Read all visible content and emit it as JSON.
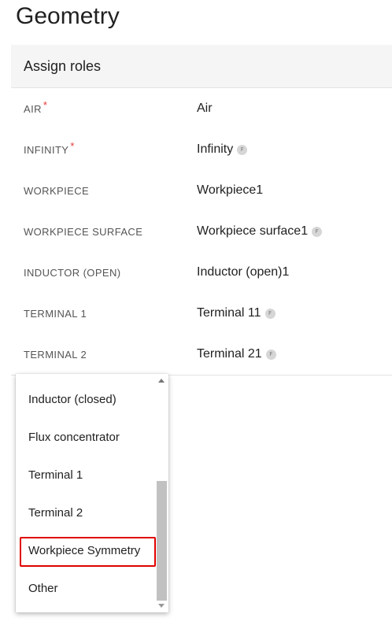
{
  "page": {
    "title": "Geometry"
  },
  "section": {
    "title": "Assign roles"
  },
  "roles": [
    {
      "name": "AIR",
      "required": "*",
      "value": "Air",
      "badge": ""
    },
    {
      "name": "INFINITY",
      "required": "*",
      "value": "Infinity",
      "badge": "F"
    },
    {
      "name": "WORKPIECE",
      "required": "",
      "value": "Workpiece1",
      "badge": ""
    },
    {
      "name": "WORKPIECE SURFACE",
      "required": "",
      "value": "Workpiece surface1",
      "badge": "F"
    },
    {
      "name": "INDUCTOR (OPEN)",
      "required": "",
      "value": "Inductor (open)1",
      "badge": ""
    },
    {
      "name": "TERMINAL 1",
      "required": "",
      "value": "Terminal 11",
      "badge": "F"
    },
    {
      "name": "TERMINAL 2",
      "required": "",
      "value": "Terminal 21",
      "badge": "F"
    }
  ],
  "dropdown": {
    "options": [
      "Inductor (closed)",
      "Flux concentrator",
      "Terminal 1",
      "Terminal 2",
      "Workpiece Symmetry",
      "Other"
    ],
    "highlighted": "Workpiece Symmetry"
  },
  "colors": {
    "required": "#e53935",
    "highlight_border": "#e00000",
    "header_bg": "#f5f5f5"
  }
}
